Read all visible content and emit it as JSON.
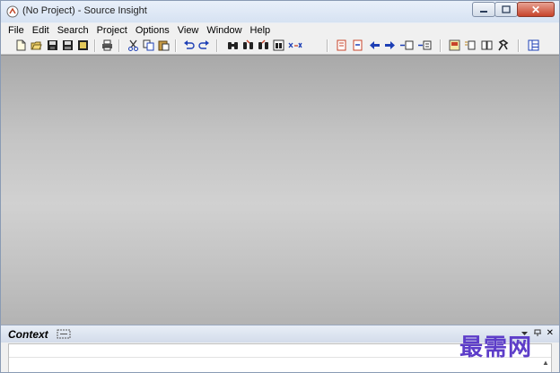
{
  "window": {
    "title": "(No Project) - Source Insight",
    "controls": [
      "minimize",
      "maximize",
      "close"
    ],
    "close_glyph": "✕"
  },
  "menu": [
    "File",
    "Edit",
    "Search",
    "Project",
    "Options",
    "View",
    "Window",
    "Help"
  ],
  "toolbar": {
    "icons": [
      "new-file-icon",
      "open-folder-icon",
      "save-icon",
      "save-all-icon",
      "close-file-icon",
      "print-icon",
      "cut-icon",
      "copy-icon",
      "paste-icon",
      "undo-icon",
      "redo-icon",
      "search-icon",
      "search-files-icon",
      "search-project-icon",
      "lookup-references-icon",
      "replace-icon",
      "bookmark-icon",
      "bookmark-next-icon",
      "back-icon",
      "forward-icon",
      "jump-prev-icon",
      "jump-next-icon",
      "symbol-window-icon",
      "relation-window-icon",
      "browse-icon",
      "activate-icon",
      "layout-icon"
    ]
  },
  "context_panel": {
    "title": "Context",
    "close_glyph": "✕"
  },
  "watermark": {
    "text": "最需网"
  },
  "colors": {
    "accent_red": "#c7432a",
    "toolbar_blue": "#1d3fb5",
    "watermark": "#5d3dc9"
  }
}
